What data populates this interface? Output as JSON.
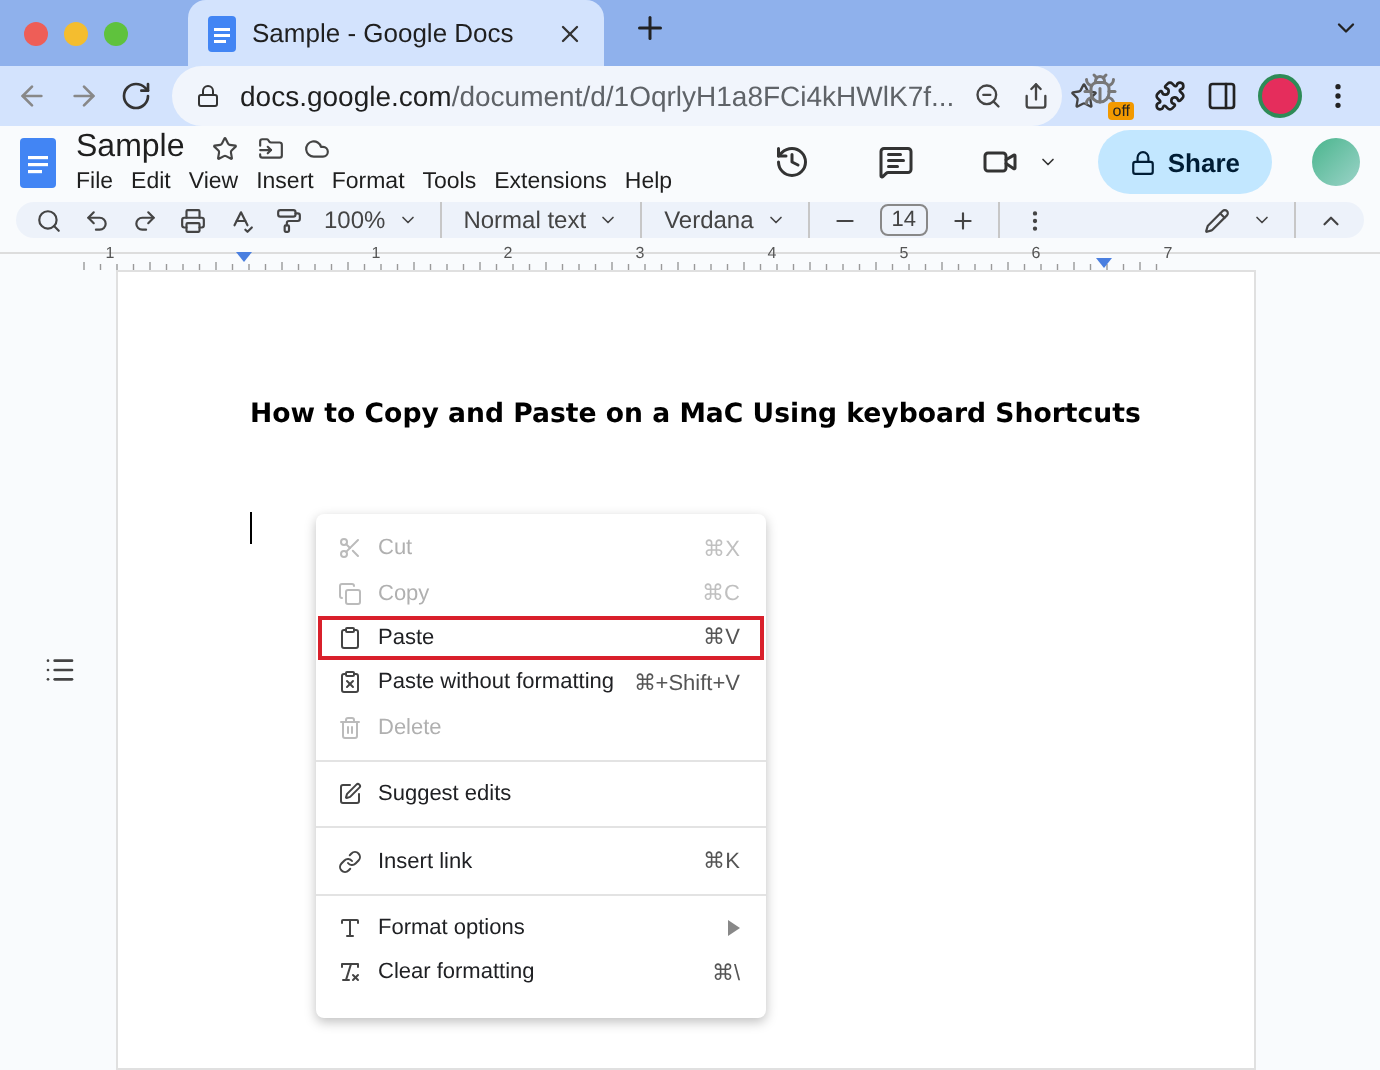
{
  "browser": {
    "tab_title": "Sample - Google Docs",
    "url_host": "docs.google.com",
    "url_path": "/document/d/1OqrlyH1a8FCi4kHWlK7f...",
    "extension_badge": "off"
  },
  "doc": {
    "title": "Sample",
    "menu": [
      "File",
      "Edit",
      "View",
      "Insert",
      "Format",
      "Tools",
      "Extensions",
      "Help"
    ],
    "share": "Share"
  },
  "toolbar": {
    "zoom": "100%",
    "style": "Normal text",
    "font": "Verdana",
    "size": "14"
  },
  "ruler": {
    "labels": [
      "1",
      "1",
      "2",
      "3",
      "4",
      "5",
      "6",
      "7"
    ]
  },
  "page": {
    "heading": "How to Copy and Paste on a MaC Using keyboard Shortcuts"
  },
  "context_menu": {
    "sections": [
      {
        "items": [
          {
            "label": "Cut",
            "shortcut": "⌘X",
            "disabled": true,
            "highlighted": false
          },
          {
            "label": "Copy",
            "shortcut": "⌘C",
            "disabled": true,
            "highlighted": false
          },
          {
            "label": "Paste",
            "shortcut": "⌘V",
            "disabled": false,
            "highlighted": true
          },
          {
            "label": "Paste without formatting",
            "shortcut": "⌘+Shift+V",
            "disabled": false,
            "highlighted": false
          },
          {
            "label": "Delete",
            "disabled": true,
            "highlighted": false
          }
        ]
      },
      {
        "items": [
          {
            "label": "Suggest edits",
            "disabled": false,
            "highlighted": false
          }
        ]
      },
      {
        "items": [
          {
            "label": "Insert link",
            "shortcut": "⌘K",
            "disabled": false,
            "highlighted": false
          }
        ]
      },
      {
        "items": [
          {
            "label": "Format options",
            "submenu": true,
            "disabled": false,
            "highlighted": false
          },
          {
            "label": "Clear formatting",
            "shortcut": "⌘\\",
            "disabled": false,
            "highlighted": false
          }
        ]
      }
    ]
  }
}
